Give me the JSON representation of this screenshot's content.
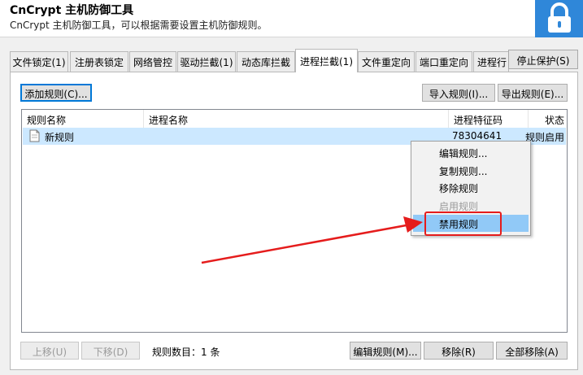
{
  "window": {
    "title": "CnCrypt 主机防御工具",
    "subtitle": "CnCrypt 主机防御工具，可以根据需要设置主机防御规则。",
    "lock_icon": "lock-icon"
  },
  "tabs": [
    {
      "label": "文件锁定(1)"
    },
    {
      "label": "注册表锁定"
    },
    {
      "label": "网络管控"
    },
    {
      "label": "驱动拦截(1)"
    },
    {
      "label": "动态库拦截"
    },
    {
      "label": "进程拦截(1)",
      "active": true
    },
    {
      "label": "文件重定向"
    },
    {
      "label": "端口重定向"
    },
    {
      "label": "进程行"
    }
  ],
  "toolbar": {
    "stop_protect": "停止保护(S)",
    "add_rule": "添加规则(C)...",
    "import_rule": "导入规则(I)...",
    "export_rule": "导出规则(E)..."
  },
  "table": {
    "columns": [
      "规则名称",
      "进程名称",
      "进程特征码",
      "状态"
    ],
    "rows": [
      {
        "name": "新规则",
        "process": "",
        "code": "78304641",
        "status": "规则启用"
      }
    ]
  },
  "context_menu": {
    "items": [
      {
        "label": "编辑规则...",
        "enabled": true
      },
      {
        "label": "复制规则...",
        "enabled": true
      },
      {
        "label": "移除规则",
        "enabled": true
      },
      {
        "label": "启用规则",
        "enabled": false
      },
      {
        "label": "禁用规则",
        "enabled": true,
        "hover": true
      }
    ]
  },
  "bottom": {
    "move_up": "上移(U)",
    "move_down": "下移(D)",
    "count_text": "规则数目：1 条",
    "edit_rule": "编辑规则(M)...",
    "remove": "移除(R)",
    "remove_all": "全部移除(A)"
  },
  "colors": {
    "accent_blue": "#2f87d9",
    "selection": "#cce8ff",
    "menu_hover": "#91c9f7",
    "annotation_red": "#e51c1c"
  }
}
